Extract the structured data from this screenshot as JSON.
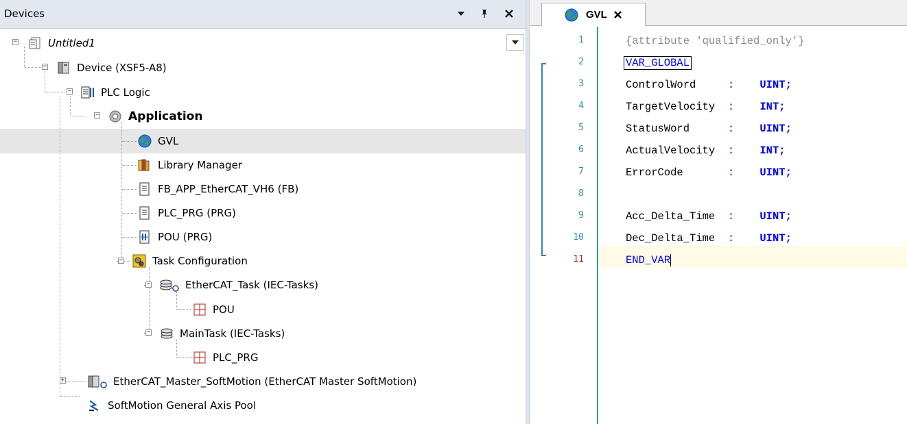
{
  "devices_panel": {
    "title": "Devices",
    "buttons": {
      "dropdown": "▾",
      "pin": "⊥",
      "close": "✕"
    },
    "tree": [
      {
        "id": "untitled",
        "label": "Untitled1"
      },
      {
        "id": "device",
        "label": "Device (XSF5-A8)"
      },
      {
        "id": "plc-logic",
        "label": "PLC Logic"
      },
      {
        "id": "application",
        "label": "Application"
      },
      {
        "id": "gvl",
        "label": "GVL"
      },
      {
        "id": "library-manager",
        "label": "Library Manager"
      },
      {
        "id": "fb-app",
        "label": "FB_APP_EtherCAT_VH6 (FB)"
      },
      {
        "id": "plc-prg",
        "label": "PLC_PRG (PRG)"
      },
      {
        "id": "pou",
        "label": "POU (PRG)"
      },
      {
        "id": "task-config",
        "label": "Task Configuration"
      },
      {
        "id": "ethercat-task",
        "label": "EtherCAT_Task (IEC-Tasks)"
      },
      {
        "id": "ethercat-task-pou",
        "label": "POU"
      },
      {
        "id": "main-task",
        "label": "MainTask (IEC-Tasks)"
      },
      {
        "id": "main-task-plc-prg",
        "label": "PLC_PRG"
      },
      {
        "id": "ethercat-master",
        "label": "EtherCAT_Master_SoftMotion (EtherCAT Master SoftMotion)"
      },
      {
        "id": "axis-pool",
        "label": "SoftMotion General Axis Pool"
      }
    ]
  },
  "editor": {
    "tab_title": "GVL",
    "tab_close": "✕",
    "line_numbers": [
      "1",
      "2",
      "3",
      "4",
      "5",
      "6",
      "7",
      "8",
      "9",
      "10",
      "11"
    ],
    "lines": {
      "l1_attr": "{attribute 'qualified_only'}",
      "l2_kw": "VAR_GLOBAL",
      "l3_name": "ControlWord     ",
      "l3_type": "UINT;",
      "l4_name": "TargetVelocity  ",
      "l4_type": "INT;",
      "l5_name": "StatusWord      ",
      "l5_type": "UINT;",
      "l6_name": "ActualVelocity  ",
      "l6_type": "INT;",
      "l7_name": "ErrorCode       ",
      "l7_type": "UINT;",
      "l9_name": "Acc_Delta_Time  ",
      "l9_type": "UINT;",
      "l10_name": "Dec_Delta_Time  ",
      "l10_type": "UINT;",
      "l11_kw": "END_VAR",
      "colon": ":"
    }
  },
  "colors": {
    "keyword": "#0000ff",
    "line_number": "#2b91af",
    "active_line_number": "#b22222",
    "gutter_line": "#2aa08a",
    "selection_row": "#e6e6e6"
  }
}
